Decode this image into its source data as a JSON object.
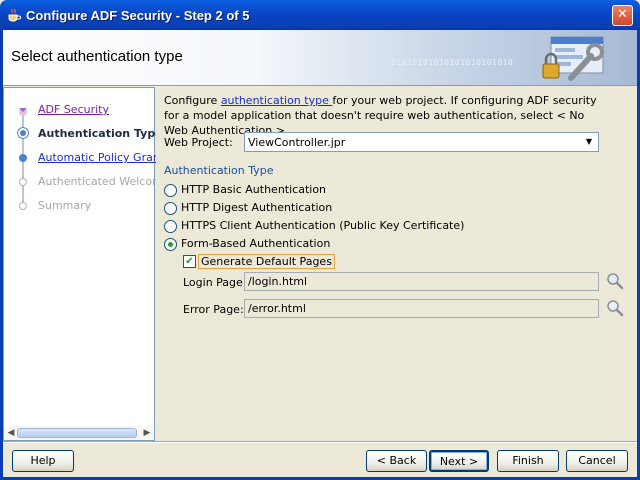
{
  "window": {
    "title": "Configure ADF Security - Step 2 of 5",
    "close_label": "✕"
  },
  "header": {
    "title": "Select authentication type",
    "binary_text": "01010101010101010101010"
  },
  "nav": {
    "items": [
      {
        "label": "ADF Security",
        "state": "visited"
      },
      {
        "label": "Authentication Type",
        "state": "current"
      },
      {
        "label": "Automatic Policy Grants",
        "state": "link"
      },
      {
        "label": "Authenticated Welcome",
        "state": "disabled"
      },
      {
        "label": "Summary",
        "state": "disabled"
      }
    ]
  },
  "content": {
    "intro_prefix": "Configure ",
    "intro_link": "authentication type ",
    "intro_suffix": "for your web project. If configuring ADF security for a model application that doesn't require web authentication, select < No Web Authentication >.",
    "web_project_label": "Web Project:",
    "web_project_value": "ViewController.jpr",
    "section_title": "Authentication Type",
    "options": [
      {
        "label": "HTTP Basic Authentication",
        "selected": false
      },
      {
        "label": "HTTP Digest Authentication",
        "selected": false
      },
      {
        "label": "HTTPS Client Authentication (Public Key Certificate)",
        "selected": false
      },
      {
        "label": "Form-Based Authentication",
        "selected": true
      }
    ],
    "generate_default_pages_label": "Generate Default Pages",
    "generate_default_pages_checked": true,
    "login_page_label": "Login Page:",
    "login_page_value": "/login.html",
    "error_page_label": "Error Page:",
    "error_page_value": "/error.html"
  },
  "buttons": {
    "help": "Help",
    "back": "< Back",
    "next": "Next >",
    "finish": "Finish",
    "cancel": "Cancel"
  },
  "colors": {
    "titlebar": "#0846c4",
    "link": "#1b2ec9",
    "visited": "#7b1ea2",
    "section": "#1a4fa6",
    "radio_selected": "#21a121"
  }
}
